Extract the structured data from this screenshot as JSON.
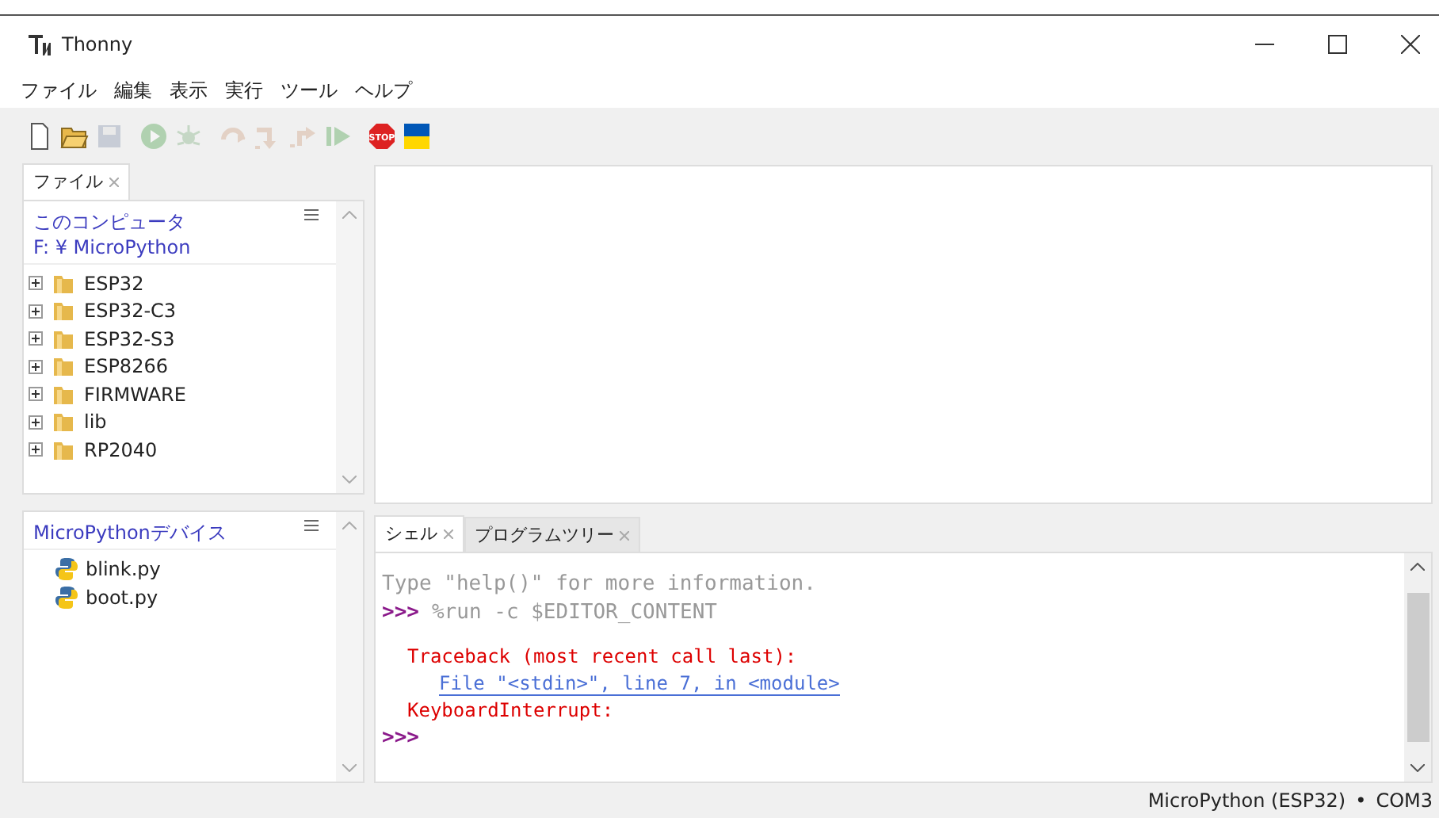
{
  "window": {
    "title": "Thonny"
  },
  "menu": [
    "ファイル",
    "編集",
    "表示",
    "実行",
    "ツール",
    "ヘルプ"
  ],
  "toolbar": [
    {
      "kind": "new",
      "disabled": false
    },
    {
      "kind": "open",
      "disabled": false
    },
    {
      "kind": "save",
      "disabled": true
    },
    {
      "kind": "run",
      "disabled": true
    },
    {
      "kind": "debug",
      "disabled": true
    },
    {
      "kind": "step-over",
      "disabled": true
    },
    {
      "kind": "step-into",
      "disabled": true
    },
    {
      "kind": "step-out",
      "disabled": true
    },
    {
      "kind": "resume",
      "disabled": true
    },
    {
      "kind": "stop",
      "disabled": false,
      "label": "STOP"
    },
    {
      "kind": "flag",
      "disabled": false
    }
  ],
  "left_tabs": [
    {
      "label": "ファイル",
      "selected": true
    }
  ],
  "files": {
    "title": "このコンピュータ",
    "path": "F: ¥ MicroPython",
    "items": [
      {
        "name": "ESP32",
        "kind": "folder"
      },
      {
        "name": "ESP32-C3",
        "kind": "folder"
      },
      {
        "name": "ESP32-S3",
        "kind": "folder"
      },
      {
        "name": "ESP8266",
        "kind": "folder"
      },
      {
        "name": "FIRMWARE",
        "kind": "folder"
      },
      {
        "name": "lib",
        "kind": "folder"
      },
      {
        "name": "RP2040",
        "kind": "folder"
      }
    ]
  },
  "device": {
    "title": "MicroPythonデバイス",
    "items": [
      {
        "name": "blink.py",
        "kind": "python"
      },
      {
        "name": "boot.py",
        "kind": "python"
      }
    ]
  },
  "shell_tabs": [
    {
      "label": "シェル",
      "selected": true
    },
    {
      "label": "プログラムツリー",
      "selected": false
    }
  ],
  "shell_lines": [
    {
      "kind": "info",
      "text": "Type \"help()\" for more information."
    },
    {
      "kind": "prompt",
      "prompt": ">>>",
      "text": "%run -c $EDITOR_CONTENT"
    },
    {
      "kind": "error",
      "text": "Traceback (most recent call last):"
    },
    {
      "kind": "link",
      "text": "File \"<stdin>\", line 7, in <module>"
    },
    {
      "kind": "error",
      "text": "KeyboardInterrupt:"
    },
    {
      "kind": "prompt",
      "prompt": ">>>"
    }
  ],
  "status_bar": {
    "interpreter": "MicroPython (ESP32)",
    "separator": "•",
    "port": "COM3"
  }
}
